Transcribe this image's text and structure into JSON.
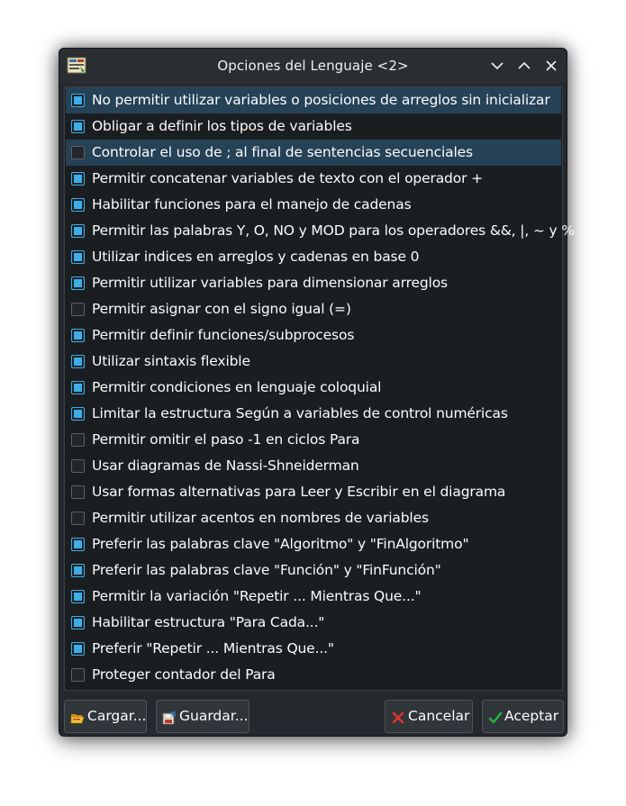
{
  "window": {
    "title": "Opciones del Lenguaje <2>",
    "app_icon": "pseint-app-icon",
    "controls": [
      "minimize-icon",
      "maximize-icon",
      "close-icon"
    ]
  },
  "options": [
    {
      "label": "No permitir utilizar variables o posiciones de arreglos sin inicializar",
      "checked": true,
      "highlighted": true
    },
    {
      "label": "Obligar a definir los tipos de variables",
      "checked": true,
      "highlighted": false
    },
    {
      "label": "Controlar el uso de ; al final de sentencias secuenciales",
      "checked": false,
      "highlighted": true
    },
    {
      "label": "Permitir concatenar variables de texto con el operador +",
      "checked": true,
      "highlighted": false
    },
    {
      "label": "Habilitar funciones para el manejo de cadenas",
      "checked": true,
      "highlighted": false
    },
    {
      "label": "Permitir las palabras Y, O, NO y MOD para los operadores &&, |, ~ y %",
      "checked": true,
      "highlighted": false
    },
    {
      "label": "Utilizar indices en arreglos y cadenas en base 0",
      "checked": true,
      "highlighted": false
    },
    {
      "label": "Permitir utilizar variables para dimensionar arreglos",
      "checked": true,
      "highlighted": false
    },
    {
      "label": "Permitir asignar con el signo igual (=)",
      "checked": false,
      "highlighted": false
    },
    {
      "label": "Permitir definir funciones/subprocesos",
      "checked": true,
      "highlighted": false
    },
    {
      "label": "Utilizar sintaxis flexible",
      "checked": true,
      "highlighted": false
    },
    {
      "label": "Permitir condiciones en lenguaje coloquial",
      "checked": true,
      "highlighted": false
    },
    {
      "label": "Limitar la estructura Según a variables de control numéricas",
      "checked": true,
      "highlighted": false
    },
    {
      "label": "Permitir omitir el paso -1 en ciclos Para",
      "checked": false,
      "highlighted": false
    },
    {
      "label": "Usar diagramas de Nassi-Shneiderman",
      "checked": false,
      "highlighted": false
    },
    {
      "label": "Usar formas alternativas para Leer y Escribir en el diagrama",
      "checked": false,
      "highlighted": false
    },
    {
      "label": "Permitir utilizar acentos en nombres de variables",
      "checked": false,
      "highlighted": false
    },
    {
      "label": "Preferir las palabras clave \"Algoritmo\" y \"FinAlgoritmo\"",
      "checked": true,
      "highlighted": false
    },
    {
      "label": "Preferir las palabras clave \"Función\" y \"FinFunción\"",
      "checked": true,
      "highlighted": false
    },
    {
      "label": "Permitir la variación \"Repetir ... Mientras Que...\"",
      "checked": true,
      "highlighted": false
    },
    {
      "label": "Habilitar estructura \"Para Cada...\"",
      "checked": true,
      "highlighted": false
    },
    {
      "label": "Preferir \"Repetir ... Mientras Que...\"",
      "checked": true,
      "highlighted": false
    },
    {
      "label": "Proteger contador del Para",
      "checked": false,
      "highlighted": false
    }
  ],
  "buttons": {
    "load": {
      "label": "Cargar...",
      "icon": "folder-open-icon"
    },
    "save": {
      "label": "Guardar...",
      "icon": "floppy-save-icon"
    },
    "cancel": {
      "label": "Cancelar",
      "icon": "red-x-icon"
    },
    "accept": {
      "label": "Aceptar",
      "icon": "green-check-icon"
    }
  },
  "colors": {
    "window_bg": "#25292e",
    "list_bg": "#1b1e20",
    "highlight": "#254257",
    "checkbox_accent": "#3daee9",
    "text": "#fcfcfc"
  }
}
